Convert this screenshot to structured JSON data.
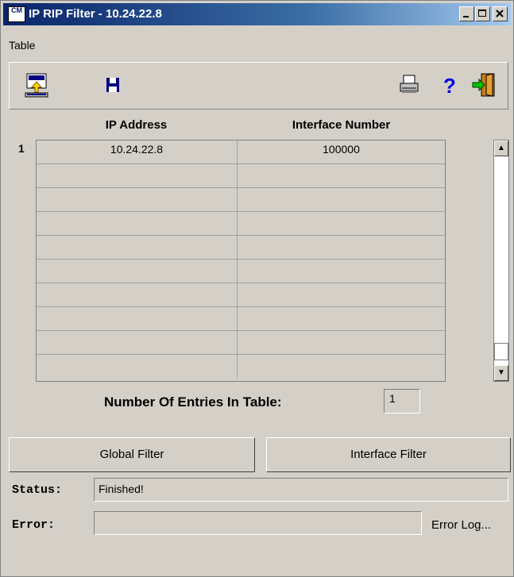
{
  "window": {
    "title": "IP RIP Filter - 10.24.22.8",
    "app_icon_text": "CM"
  },
  "menu": {
    "items": [
      "Table"
    ]
  },
  "toolbar": {
    "icons": [
      "upload-icon",
      "save-icon",
      "print-icon",
      "help-icon",
      "exit-icon"
    ]
  },
  "table": {
    "columns": [
      "IP Address",
      "Interface Number"
    ],
    "row_number": "1",
    "rows": [
      {
        "ip": "10.24.22.8",
        "interface": "100000"
      },
      {
        "ip": "",
        "interface": ""
      },
      {
        "ip": "",
        "interface": ""
      },
      {
        "ip": "",
        "interface": ""
      },
      {
        "ip": "",
        "interface": ""
      },
      {
        "ip": "",
        "interface": ""
      },
      {
        "ip": "",
        "interface": ""
      },
      {
        "ip": "",
        "interface": ""
      },
      {
        "ip": "",
        "interface": ""
      },
      {
        "ip": "",
        "interface": ""
      }
    ]
  },
  "entries": {
    "label": "Number Of Entries In Table:",
    "value": "1"
  },
  "buttons": {
    "global_filter": "Global Filter",
    "interface_filter": "Interface Filter",
    "error_log": "Error Log..."
  },
  "status": {
    "label": "Status:",
    "value": "Finished!"
  },
  "error": {
    "label": "Error:",
    "value": ""
  },
  "colors": {
    "titlebar": "#0a246a",
    "face": "#d4d0c8"
  }
}
